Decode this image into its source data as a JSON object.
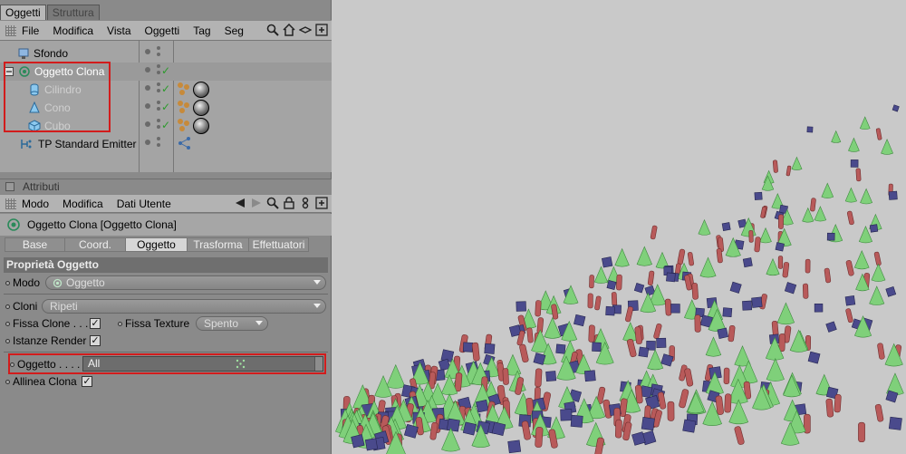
{
  "object_manager": {
    "tabs": [
      "Oggetti",
      "Struttura"
    ],
    "menu": [
      "File",
      "Modifica",
      "Vista",
      "Oggetti",
      "Tag",
      "Seg"
    ],
    "rows": [
      {
        "label": "Sfondo",
        "icon": "background-icon"
      },
      {
        "label": "Oggetto Clona",
        "icon": "cloner-icon"
      },
      {
        "label": "Cilindro",
        "icon": "cylinder-icon"
      },
      {
        "label": "Cono",
        "icon": "cone-icon"
      },
      {
        "label": "Cubo",
        "icon": "cube-icon"
      },
      {
        "label": "TP Standard Emitter",
        "icon": "emitter-icon"
      }
    ]
  },
  "attributes": {
    "header": "Attributi",
    "menu": [
      "Modo",
      "Modifica",
      "Dati Utente"
    ],
    "object_title": "Oggetto Clona [Oggetto Clona]",
    "tabs": [
      "Base",
      "Coord.",
      "Oggetto",
      "Trasforma",
      "Effettuatori"
    ],
    "active_tab": "Oggetto",
    "section": "Proprietà Oggetto",
    "modo_label": "Modo",
    "modo_value": "Oggetto",
    "cloni_label": "Cloni",
    "cloni_value": "Ripeti",
    "fissa_clone_label": "Fissa Clone . . .",
    "fissa_texture_label": "Fissa Texture",
    "fissa_texture_value": "Spento",
    "istanze_render_label": "Istanze Render",
    "oggetto_label": "Oggetto . . . .",
    "oggetto_value": "All",
    "allinea_clona_label": "Allinea Clona"
  },
  "colors": {
    "cone": "#7fd07a",
    "cylinder": "#b85a5a",
    "cube": "#4a4a8c",
    "highlight": "#d21c1c"
  }
}
